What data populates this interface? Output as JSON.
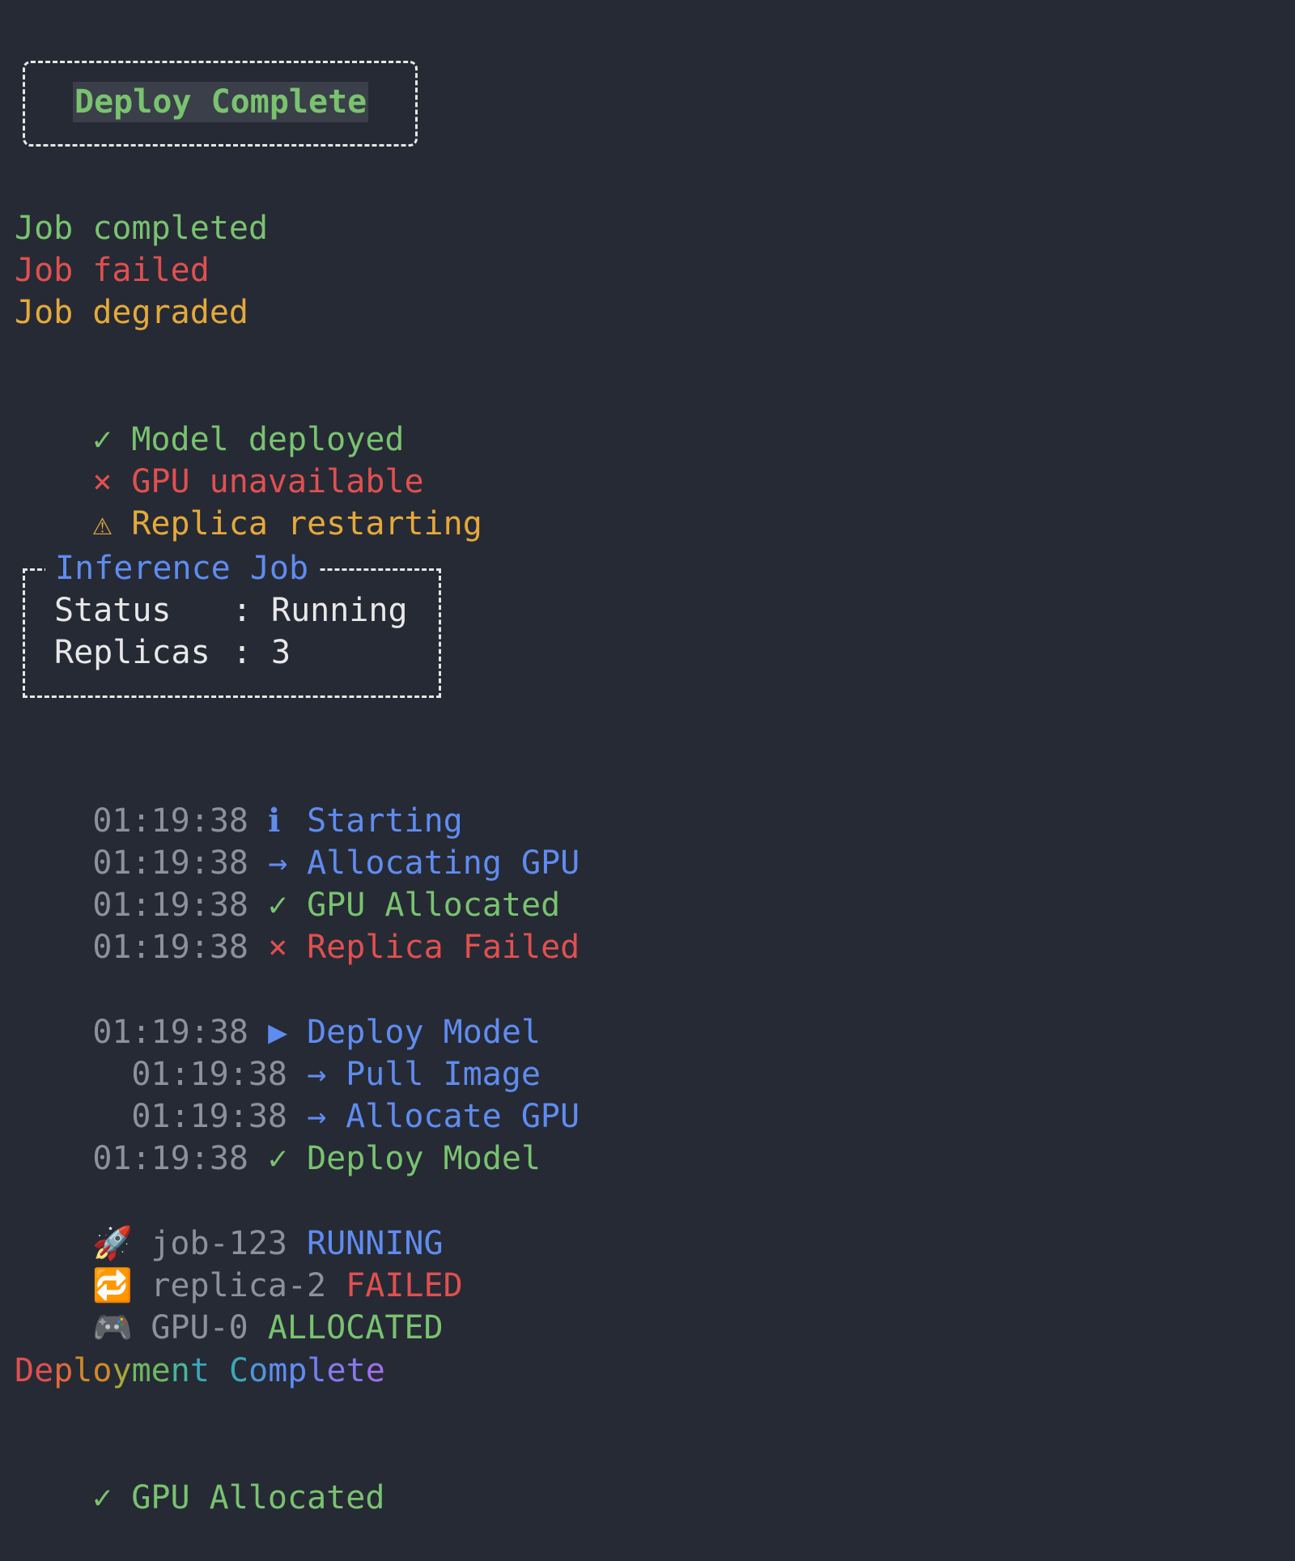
{
  "banner": {
    "text": "Deploy Complete"
  },
  "job_states": [
    {
      "text": "Job completed",
      "color": "#79c36f"
    },
    {
      "text": "Job failed",
      "color": "#e0504f"
    },
    {
      "text": "Job degraded",
      "color": "#e5a93a"
    }
  ],
  "status_items": [
    {
      "icon": "✓",
      "icon_name": "check-icon",
      "text": "Model deployed",
      "color": "#79c36f"
    },
    {
      "icon": "×",
      "icon_name": "cross-icon",
      "text": "GPU unavailable",
      "color": "#e0504f"
    },
    {
      "icon": "⚠",
      "icon_name": "warning-icon",
      "text": "Replica restarting",
      "color": "#e5a93a"
    }
  ],
  "panel": {
    "title": "Inference Job",
    "rows": [
      {
        "key": "Status",
        "sep": ":",
        "value": "Running"
      },
      {
        "key": "Replicas",
        "sep": ":",
        "value": "3"
      }
    ]
  },
  "log": [
    {
      "time": "01:19:38",
      "icon": "ℹ",
      "icon_name": "info-icon",
      "text": "Starting",
      "color": "#5f8cf0"
    },
    {
      "time": "01:19:38",
      "icon": "→",
      "icon_name": "arrow-right-icon",
      "text": "Allocating GPU",
      "color": "#5f8cf0"
    },
    {
      "time": "01:19:38",
      "icon": "✓",
      "icon_name": "check-icon",
      "text": "GPU Allocated",
      "color": "#79c36f"
    },
    {
      "time": "01:19:38",
      "icon": "×",
      "icon_name": "cross-icon",
      "text": "Replica Failed",
      "color": "#e0504f"
    }
  ],
  "task_log": [
    {
      "time": "01:19:38",
      "icon": "▶",
      "icon_name": "play-icon",
      "text": "Deploy Model",
      "color": "#5f8cf0",
      "indent": 0
    },
    {
      "time": "01:19:38",
      "icon": "→",
      "icon_name": "arrow-right-icon",
      "text": "Pull Image",
      "color": "#5f8cf0",
      "indent": 1
    },
    {
      "time": "01:19:38",
      "icon": "→",
      "icon_name": "arrow-right-icon",
      "text": "Allocate GPU",
      "color": "#5f8cf0",
      "indent": 1
    },
    {
      "time": "01:19:38",
      "icon": "✓",
      "icon_name": "check-icon",
      "text": "Deploy Model",
      "color": "#79c36f",
      "indent": 0
    }
  ],
  "resources": [
    {
      "emoji": "🚀",
      "icon_name": "rocket-icon",
      "name": "job-123",
      "state": "RUNNING",
      "color": "#5f8cf0"
    },
    {
      "emoji": "🔁",
      "icon_name": "repeat-icon",
      "name": "replica-2",
      "state": "FAILED",
      "color": "#e0504f"
    },
    {
      "emoji": "🎮",
      "icon_name": "gamepad-icon",
      "name": "GPU-0",
      "state": "ALLOCATED",
      "color": "#79c36f"
    }
  ],
  "gradient_text": {
    "text": "Deployment Complete",
    "colors": [
      "#e0504f",
      "#e06a3a",
      "#d08a2a",
      "#a8a83a",
      "#6fb860",
      "#45b89a",
      "#3aa8b8",
      "#4f95d8",
      "#5f8cf0",
      "#7080f0",
      "#8a78ee",
      "#a070ea"
    ]
  },
  "final": {
    "icon": "✓",
    "text": "GPU Allocated",
    "color": "#79c36f"
  }
}
